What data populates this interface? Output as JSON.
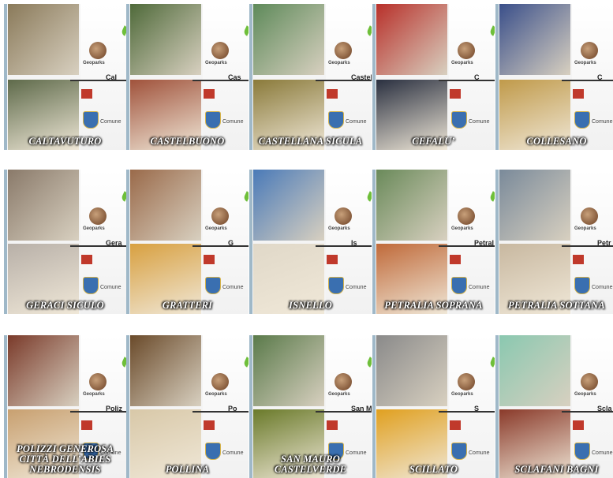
{
  "tiles": [
    {
      "name": "CALTAVUTURO",
      "tag": "Cal",
      "a": "#8a7a5a",
      "b": "#5e6a4a"
    },
    {
      "name": "CASTELBUONO",
      "tag": "Cas",
      "a": "#4f6a3a",
      "b": "#a0523b"
    },
    {
      "name": "CASTELLANA SICULA",
      "tag": "Castel",
      "a": "#5e8a5a",
      "b": "#8a7a3a"
    },
    {
      "name": "CEFALU’",
      "tag": "C",
      "a": "#b8302a",
      "b": "#2a3040"
    },
    {
      "name": "COLLESANO",
      "tag": "C",
      "a": "#3a4f8a",
      "b": "#c09a4a"
    },
    {
      "name": "GERACI SICULO",
      "tag": "Gera",
      "a": "#8a7a6a",
      "b": "#b8b0a8"
    },
    {
      "name": "GRATTERI",
      "tag": "G",
      "a": "#9a6a4a",
      "b": "#d8a040"
    },
    {
      "name": "ISNELLO",
      "tag": "Is",
      "a": "#4a7ab8",
      "b": "#e0d8c8"
    },
    {
      "name": "PETRALIA SOPRANA",
      "tag": "Petral",
      "a": "#6a8a5a",
      "b": "#c06a3a"
    },
    {
      "name": "PETRALIA SOTTANA",
      "tag": "Petr",
      "a": "#7a8a9a",
      "b": "#c8b8a0"
    },
    {
      "name": "POLIZZI GENEROSA CITTÀ DELL’ABIES NEBRODENSIS",
      "tag": "Poliz",
      "a": "#7a3a2a",
      "b": "#c8a070"
    },
    {
      "name": "POLLINA",
      "tag": "Po",
      "a": "#6a4a2a",
      "b": "#d8c8a8"
    },
    {
      "name": "SAN MAURO CASTELVERDE",
      "tag": "San Mau",
      "a": "#5a7a4a",
      "b": "#6a7a2a"
    },
    {
      "name": "SCILLATO",
      "tag": "S",
      "a": "#8a8a8a",
      "b": "#e0a020"
    },
    {
      "name": "SCLAFANI BAGNI",
      "tag": "Scla",
      "a": "#8ac8b0",
      "b": "#8a3a2a"
    }
  ],
  "brand": {
    "geoparks": "Geoparks",
    "comune": "Comune"
  }
}
